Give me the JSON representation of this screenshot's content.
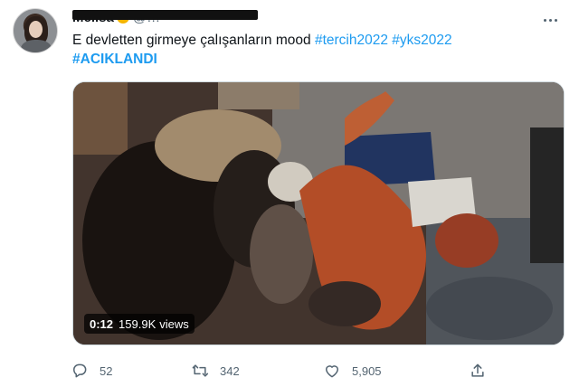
{
  "tweet": {
    "author": {
      "display_name": "Melisa",
      "handle": "@…"
    },
    "text_plain": "E devletten girmeye çalışanların mood ",
    "hashtags": [
      "#tercih2022",
      "#yks2022",
      "#ACIKLANDI"
    ],
    "media": {
      "type": "video",
      "duration": "0:12",
      "views_count": "159.9K",
      "views_label": "views"
    },
    "stats": {
      "replies": "52",
      "retweets": "342",
      "likes": "5,905"
    }
  },
  "icons": {
    "more": "more-horizontal-icon",
    "reply": "reply-icon",
    "retweet": "retweet-icon",
    "like": "heart-icon",
    "share": "share-icon",
    "verified": "emoji-badge-icon"
  },
  "colors": {
    "accent": "#1d9bf0",
    "text": "#0f1419",
    "secondary": "#536471"
  }
}
